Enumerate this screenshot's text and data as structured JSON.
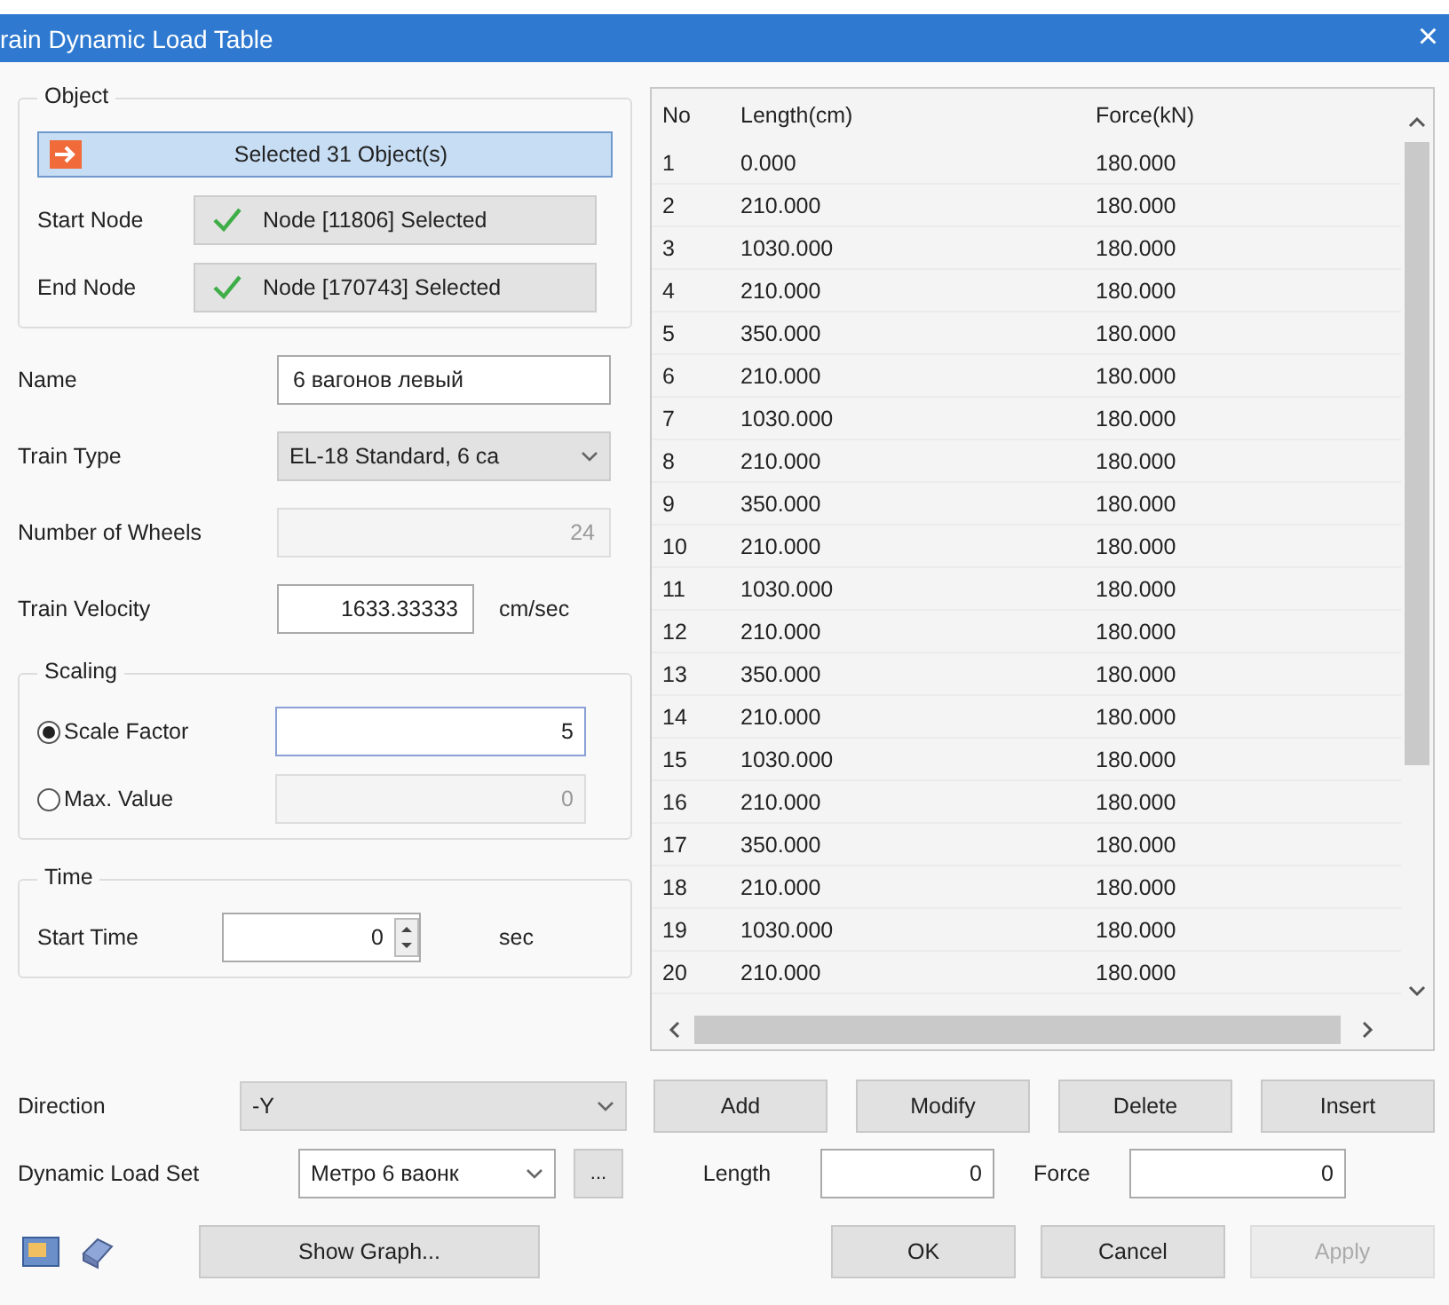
{
  "window": {
    "title": "rain Dynamic Load Table",
    "close": "×"
  },
  "object_group": {
    "title": "Object",
    "select_button": "Selected 31 Object(s)",
    "nodes": [
      {
        "label": "Start Node",
        "value": "Node [11806] Selected",
        "checked": true
      },
      {
        "label": "End Node",
        "value": "Node [170743] Selected",
        "checked": true
      }
    ]
  },
  "fields": [
    {
      "kind": "text",
      "label": "Name",
      "value": "6 вагонов левый",
      "disabled": false
    },
    {
      "kind": "dropdown",
      "label": "Train Type",
      "value": "EL-18 Standard, 6 ca",
      "disabled": true
    },
    {
      "kind": "number",
      "label": "Number of Wheels",
      "value": "24",
      "disabled": true
    },
    {
      "kind": "number",
      "label": "Train Velocity",
      "value": "1633.33333",
      "unit": "cm/sec",
      "disabled": false
    }
  ],
  "scaling": {
    "title": "Scaling",
    "options": [
      {
        "label": "Scale Factor",
        "selected": true,
        "value": "5"
      },
      {
        "label": "Max. Value",
        "selected": false,
        "value": "0"
      }
    ]
  },
  "time": {
    "title": "Time",
    "start_time": {
      "label": "Start Time",
      "value": "0",
      "unit": "sec"
    }
  },
  "table": {
    "columns": [
      "No",
      "Length(cm)",
      "Force(kN)"
    ],
    "rows": [
      [
        "1",
        "0.000",
        "180.000"
      ],
      [
        "2",
        "210.000",
        "180.000"
      ],
      [
        "3",
        "1030.000",
        "180.000"
      ],
      [
        "4",
        "210.000",
        "180.000"
      ],
      [
        "5",
        "350.000",
        "180.000"
      ],
      [
        "6",
        "210.000",
        "180.000"
      ],
      [
        "7",
        "1030.000",
        "180.000"
      ],
      [
        "8",
        "210.000",
        "180.000"
      ],
      [
        "9",
        "350.000",
        "180.000"
      ],
      [
        "10",
        "210.000",
        "180.000"
      ],
      [
        "11",
        "1030.000",
        "180.000"
      ],
      [
        "12",
        "210.000",
        "180.000"
      ],
      [
        "13",
        "350.000",
        "180.000"
      ],
      [
        "14",
        "210.000",
        "180.000"
      ],
      [
        "15",
        "1030.000",
        "180.000"
      ],
      [
        "16",
        "210.000",
        "180.000"
      ],
      [
        "17",
        "350.000",
        "180.000"
      ],
      [
        "18",
        "210.000",
        "180.000"
      ],
      [
        "19",
        "1030.000",
        "180.000"
      ],
      [
        "20",
        "210.000",
        "180.000"
      ]
    ]
  },
  "direction": {
    "label": "Direction",
    "value": "-Y"
  },
  "table_buttons": [
    "Add",
    "Modify",
    "Delete",
    "Insert"
  ],
  "dynamic_load_set": {
    "label": "Dynamic Load Set",
    "value": "Метро 6 ваонк",
    "browse": "..."
  },
  "entry_fields": [
    {
      "label": "Length",
      "value": "0"
    },
    {
      "label": "Force",
      "value": "0"
    }
  ],
  "show_graph": "Show Graph...",
  "dialog_buttons": [
    {
      "label": "OK",
      "disabled": false
    },
    {
      "label": "Cancel",
      "disabled": false
    },
    {
      "label": "Apply",
      "disabled": true
    }
  ]
}
